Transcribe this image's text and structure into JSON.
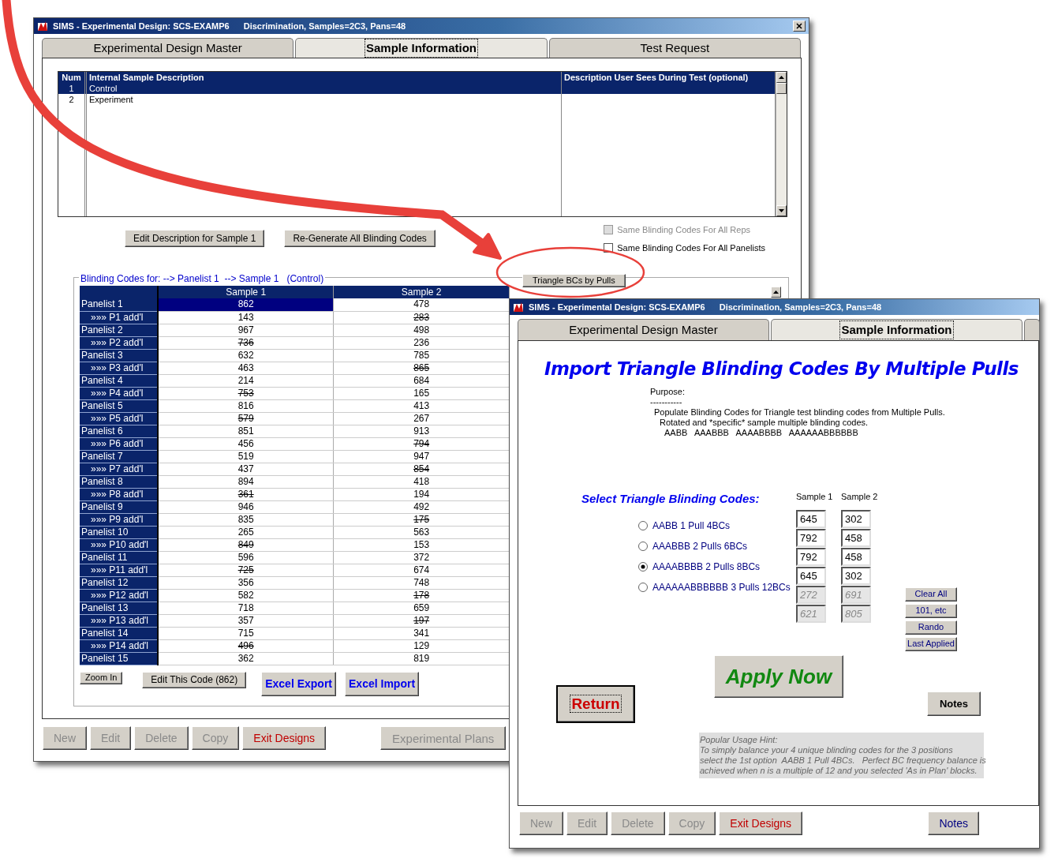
{
  "main_window": {
    "title": "SIMS - Experimental Design: SCS-EXAMP6",
    "subtitle": "Discrimination, Samples=2C3, Pans=48",
    "tabs": [
      {
        "label": "Experimental Design Master",
        "selected": false
      },
      {
        "label": "Sample Information",
        "selected": true
      },
      {
        "label": "Test Request",
        "selected": false
      }
    ],
    "sample_list": {
      "columns": [
        "Num",
        "Internal Sample Description",
        "Description User Sees During Test (optional)"
      ],
      "rows": [
        {
          "num": "1",
          "description": "Control",
          "selected": true
        },
        {
          "num": "2",
          "description": "Experiment",
          "selected": false
        }
      ]
    },
    "buttons": [
      "Edit Description for Sample 1",
      "Re-Generate All Blinding Codes"
    ],
    "checkboxes": [
      {
        "label": "Same Blinding Codes For All Reps",
        "checked": false,
        "disabled": true
      },
      {
        "label": "Same Blinding Codes For All Panelists",
        "checked": false,
        "disabled": false
      }
    ],
    "triangle_button": "Triangle BCs by Pulls",
    "blinding_codes": {
      "legend": "Blinding Codes for: --> Panelist 1  --> Sample 1   (Control)",
      "columns": [
        "Sample 1",
        "Sample 2"
      ],
      "rows": [
        {
          "label": "Panelist 1",
          "kind": "panelist",
          "cells": [
            {
              "value": "862",
              "struck": false,
              "selected": true
            },
            {
              "value": "478",
              "struck": false,
              "selected": false
            }
          ]
        },
        {
          "label": "»»» P1 add'l",
          "kind": "additional",
          "cells": [
            {
              "value": "143",
              "struck": false,
              "selected": false
            },
            {
              "value": "283",
              "struck": true,
              "selected": false
            }
          ]
        },
        {
          "label": "Panelist 2",
          "kind": "panelist",
          "cells": [
            {
              "value": "967",
              "struck": false,
              "selected": false
            },
            {
              "value": "498",
              "struck": false,
              "selected": false
            }
          ]
        },
        {
          "label": "»»» P2 add'l",
          "kind": "additional",
          "cells": [
            {
              "value": "736",
              "struck": true,
              "selected": false
            },
            {
              "value": "236",
              "struck": false,
              "selected": false
            }
          ]
        },
        {
          "label": "Panelist 3",
          "kind": "panelist",
          "cells": [
            {
              "value": "632",
              "struck": false,
              "selected": false
            },
            {
              "value": "785",
              "struck": false,
              "selected": false
            }
          ]
        },
        {
          "label": "»»» P3 add'l",
          "kind": "additional",
          "cells": [
            {
              "value": "463",
              "struck": false,
              "selected": false
            },
            {
              "value": "865",
              "struck": true,
              "selected": false
            }
          ]
        },
        {
          "label": "Panelist 4",
          "kind": "panelist",
          "cells": [
            {
              "value": "214",
              "struck": false,
              "selected": false
            },
            {
              "value": "684",
              "struck": false,
              "selected": false
            }
          ]
        },
        {
          "label": "»»» P4 add'l",
          "kind": "additional",
          "cells": [
            {
              "value": "753",
              "struck": true,
              "selected": false
            },
            {
              "value": "165",
              "struck": false,
              "selected": false
            }
          ]
        },
        {
          "label": "Panelist 5",
          "kind": "panelist",
          "cells": [
            {
              "value": "816",
              "struck": false,
              "selected": false
            },
            {
              "value": "413",
              "struck": false,
              "selected": false
            }
          ]
        },
        {
          "label": "»»» P5 add'l",
          "kind": "additional",
          "cells": [
            {
              "value": "579",
              "struck": true,
              "selected": false
            },
            {
              "value": "267",
              "struck": false,
              "selected": false
            }
          ]
        },
        {
          "label": "Panelist 6",
          "kind": "panelist",
          "cells": [
            {
              "value": "851",
              "struck": false,
              "selected": false
            },
            {
              "value": "913",
              "struck": false,
              "selected": false
            }
          ]
        },
        {
          "label": "»»» P6 add'l",
          "kind": "additional",
          "cells": [
            {
              "value": "456",
              "struck": false,
              "selected": false
            },
            {
              "value": "794",
              "struck": true,
              "selected": false
            }
          ]
        },
        {
          "label": "Panelist 7",
          "kind": "panelist",
          "cells": [
            {
              "value": "519",
              "struck": false,
              "selected": false
            },
            {
              "value": "947",
              "struck": false,
              "selected": false
            }
          ]
        },
        {
          "label": "»»» P7 add'l",
          "kind": "additional",
          "cells": [
            {
              "value": "437",
              "struck": false,
              "selected": false
            },
            {
              "value": "854",
              "struck": true,
              "selected": false
            }
          ]
        },
        {
          "label": "Panelist 8",
          "kind": "panelist",
          "cells": [
            {
              "value": "894",
              "struck": false,
              "selected": false
            },
            {
              "value": "418",
              "struck": false,
              "selected": false
            }
          ]
        },
        {
          "label": "»»» P8 add'l",
          "kind": "additional",
          "cells": [
            {
              "value": "361",
              "struck": true,
              "selected": false
            },
            {
              "value": "194",
              "struck": false,
              "selected": false
            }
          ]
        },
        {
          "label": "Panelist 9",
          "kind": "panelist",
          "cells": [
            {
              "value": "946",
              "struck": false,
              "selected": false
            },
            {
              "value": "492",
              "struck": false,
              "selected": false
            }
          ]
        },
        {
          "label": "»»» P9 add'l",
          "kind": "additional",
          "cells": [
            {
              "value": "835",
              "struck": false,
              "selected": false
            },
            {
              "value": "175",
              "struck": true,
              "selected": false
            }
          ]
        },
        {
          "label": "Panelist 10",
          "kind": "panelist",
          "cells": [
            {
              "value": "265",
              "struck": false,
              "selected": false
            },
            {
              "value": "563",
              "struck": false,
              "selected": false
            }
          ]
        },
        {
          "label": "»»» P10 add'l",
          "kind": "additional",
          "cells": [
            {
              "value": "849",
              "struck": true,
              "selected": false
            },
            {
              "value": "153",
              "struck": false,
              "selected": false
            }
          ]
        },
        {
          "label": "Panelist 11",
          "kind": "panelist",
          "cells": [
            {
              "value": "596",
              "struck": false,
              "selected": false
            },
            {
              "value": "372",
              "struck": false,
              "selected": false
            }
          ]
        },
        {
          "label": "»»» P11 add'l",
          "kind": "additional",
          "cells": [
            {
              "value": "725",
              "struck": true,
              "selected": false
            },
            {
              "value": "674",
              "struck": false,
              "selected": false
            }
          ]
        },
        {
          "label": "Panelist 12",
          "kind": "panelist",
          "cells": [
            {
              "value": "356",
              "struck": false,
              "selected": false
            },
            {
              "value": "748",
              "struck": false,
              "selected": false
            }
          ]
        },
        {
          "label": "»»» P12 add'l",
          "kind": "additional",
          "cells": [
            {
              "value": "582",
              "struck": false,
              "selected": false
            },
            {
              "value": "178",
              "struck": true,
              "selected": false
            }
          ]
        },
        {
          "label": "Panelist 13",
          "kind": "panelist",
          "cells": [
            {
              "value": "718",
              "struck": false,
              "selected": false
            },
            {
              "value": "659",
              "struck": false,
              "selected": false
            }
          ]
        },
        {
          "label": "»»» P13 add'l",
          "kind": "additional",
          "cells": [
            {
              "value": "357",
              "struck": false,
              "selected": false
            },
            {
              "value": "197",
              "struck": true,
              "selected": false
            }
          ]
        },
        {
          "label": "Panelist 14",
          "kind": "panelist",
          "cells": [
            {
              "value": "715",
              "struck": false,
              "selected": false
            },
            {
              "value": "341",
              "struck": false,
              "selected": false
            }
          ]
        },
        {
          "label": "»»» P14 add'l",
          "kind": "additional",
          "cells": [
            {
              "value": "496",
              "struck": true,
              "selected": false
            },
            {
              "value": "129",
              "struck": false,
              "selected": false
            }
          ]
        },
        {
          "label": "Panelist 15",
          "kind": "panelist",
          "cells": [
            {
              "value": "362",
              "struck": false,
              "selected": false
            },
            {
              "value": "819",
              "struck": false,
              "selected": false
            }
          ]
        }
      ]
    },
    "grid_buttons": [
      {
        "label": "Zoom In",
        "kind": "small"
      },
      {
        "label": "Edit This Code (862)",
        "kind": "standard"
      },
      {
        "label": "Excel Export",
        "kind": "excel"
      },
      {
        "label": "Excel Import",
        "kind": "excel"
      }
    ],
    "footer_buttons": [
      {
        "label": "New",
        "kind": "standard",
        "disabled": true
      },
      {
        "label": "Edit",
        "kind": "standard",
        "disabled": true
      },
      {
        "label": "Delete",
        "kind": "standard",
        "disabled": true
      },
      {
        "label": "Copy",
        "kind": "standard",
        "disabled": true
      },
      {
        "label": "Exit Designs",
        "kind": "exit",
        "disabled": false
      },
      {
        "label": "Experimental Plans",
        "kind": "plans",
        "disabled": true
      }
    ]
  },
  "dialog_window": {
    "title": "SIMS - Experimental Design: SCS-EXAMP6",
    "subtitle": "Discrimination, Samples=2C3, Pans=48",
    "tabs": [
      {
        "label": "Experimental Design Master",
        "selected": false
      },
      {
        "label": "Sample Information",
        "selected": true
      }
    ],
    "heading": "Import Triangle Blinding Codes By Multiple Pulls",
    "purpose": [
      "Purpose:",
      "-----------",
      "Populate Blinding Codes for Triangle test blinding codes from Multiple Pulls.",
      "Rotated and *specific* sample multiple blinding codes.",
      "AABB   AAABBB   AAAABBBB   AAAAAABBBBBB"
    ],
    "select_label": "Select Triangle Blinding Codes:",
    "options": [
      {
        "label": "AABB 1 Pull 4BCs",
        "selected": false
      },
      {
        "label": "AAABBB 2 Pulls 6BCs",
        "selected": false
      },
      {
        "label": "AAAABBBB 2 Pulls 8BCs",
        "selected": true
      },
      {
        "label": "AAAAAABBBBBB 3 Pulls 12BCs",
        "selected": false
      }
    ],
    "code_columns": [
      "Sample 1",
      "Sample 2"
    ],
    "codes": [
      {
        "sample_1": "645",
        "sample_2": "302",
        "disabled": false
      },
      {
        "sample_1": "792",
        "sample_2": "458",
        "disabled": false
      },
      {
        "sample_1": "792",
        "sample_2": "458",
        "disabled": false
      },
      {
        "sample_1": "645",
        "sample_2": "302",
        "disabled": false
      },
      {
        "sample_1": "272",
        "sample_2": "691",
        "disabled": true
      },
      {
        "sample_1": "621",
        "sample_2": "805",
        "disabled": true
      }
    ],
    "side_buttons": [
      "Clear All",
      "101, etc",
      "Rando",
      "Last Applied"
    ],
    "apply_button": "Apply Now",
    "return_button": "Return",
    "notes_button": "Notes",
    "hint": [
      "Popular Usage Hint:",
      "To simply balance your 4 unique blinding codes for the 3 positions",
      "select the 1st option  AABB 1 Pull 4BCs.   Perfect BC frequency balance is",
      "achieved when n is a multiple of 12 and you selected 'As in Plan' blocks."
    ],
    "footer_buttons": [
      {
        "label": "New",
        "kind": "standard",
        "disabled": true
      },
      {
        "label": "Edit",
        "kind": "standard",
        "disabled": true
      },
      {
        "label": "Delete",
        "kind": "standard",
        "disabled": true
      },
      {
        "label": "Copy",
        "kind": "standard",
        "disabled": true
      },
      {
        "label": "Exit Designs",
        "kind": "exit",
        "disabled": false
      },
      {
        "label": "Notes",
        "kind": "notes",
        "disabled": false
      }
    ]
  }
}
